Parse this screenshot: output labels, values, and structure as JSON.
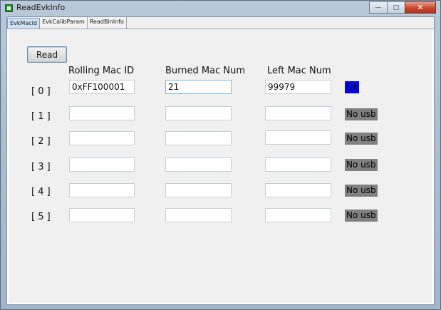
{
  "window": {
    "title": "ReadEvkInfo"
  },
  "tabs": [
    {
      "label": "EvkMacId",
      "active": true
    },
    {
      "label": "EvkCalibParam",
      "active": false
    },
    {
      "label": "ReadBinInfo",
      "active": false
    }
  ],
  "panel": {
    "read_label": "Read",
    "headers": {
      "rolling": "Rolling Mac ID",
      "burned": "Burned Mac Num",
      "left": "Left Mac Num"
    },
    "rows": [
      {
        "label": "[ 0 ]",
        "rolling": "0xFF100001",
        "burned": "21",
        "left": "99979",
        "status": "Ok"
      },
      {
        "label": "[ 1 ]",
        "rolling": "",
        "burned": "",
        "left": "",
        "status": "No usb"
      },
      {
        "label": "[ 2 ]",
        "rolling": "",
        "burned": "",
        "left": "",
        "status": "No usb"
      },
      {
        "label": "[ 3 ]",
        "rolling": "",
        "burned": "",
        "left": "",
        "status": "No usb"
      },
      {
        "label": "[ 4 ]",
        "rolling": "",
        "burned": "",
        "left": "",
        "status": "No usb"
      },
      {
        "label": "[ 5 ]",
        "rolling": "",
        "burned": "",
        "left": "",
        "status": "No usb"
      }
    ]
  },
  "colors": {
    "status_ok_bg": "#0000ff",
    "status_ok_fg": "#000000",
    "status_nousb_bg": "#808080",
    "status_nousb_fg": "#000000"
  }
}
